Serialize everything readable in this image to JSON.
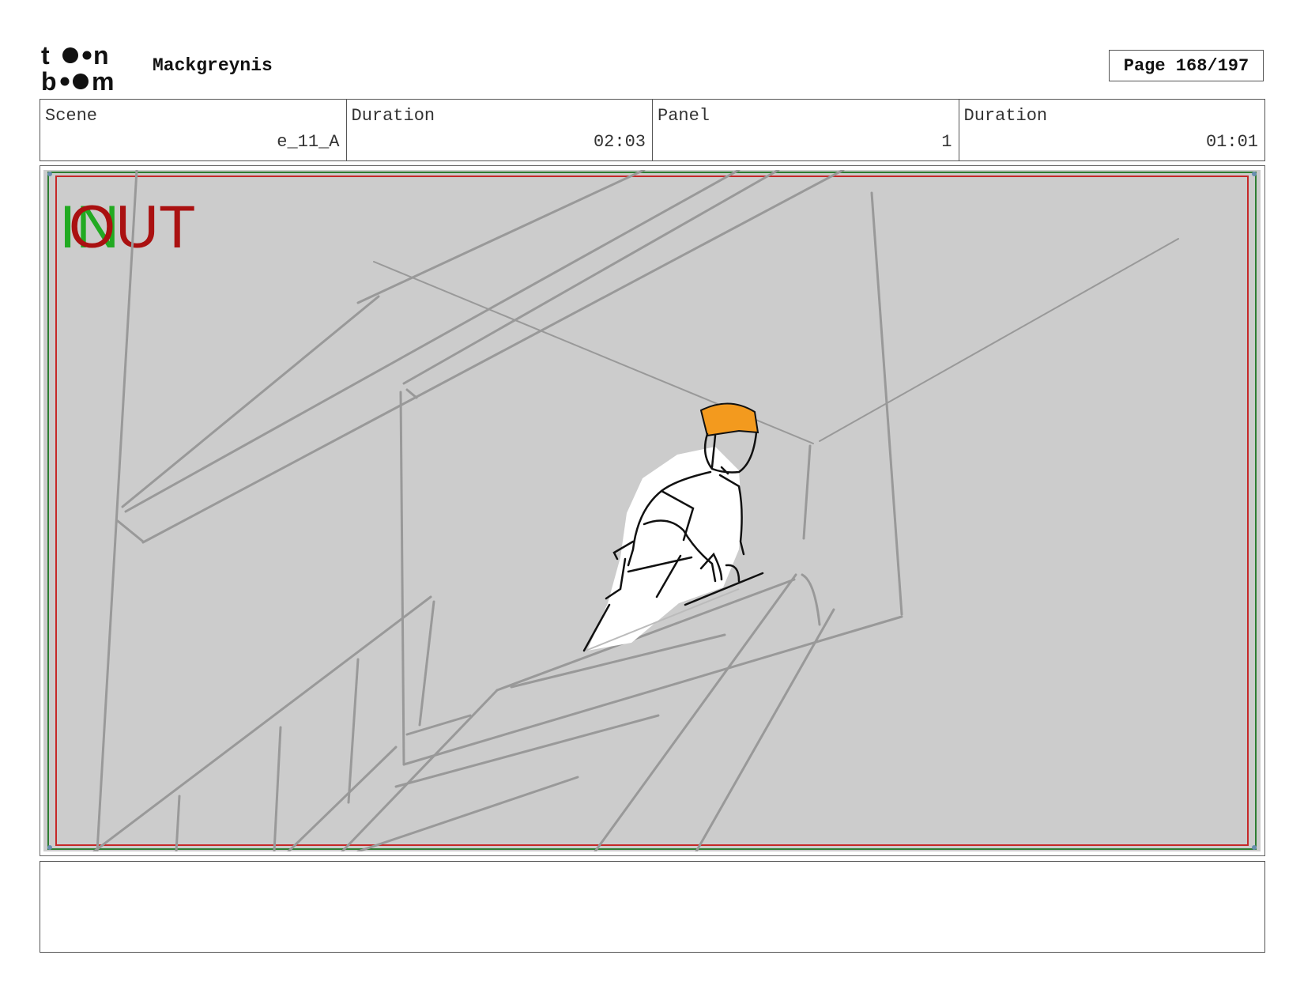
{
  "header": {
    "logo_top": "t●●n",
    "logo_bottom": "b●●m",
    "project_name": "Mackgreynis",
    "page_label": "Page 168/197"
  },
  "info": {
    "scene_label": "Scene",
    "scene_value": "e_11_A",
    "scene_duration_label": "Duration",
    "scene_duration_value": "02:03",
    "panel_label": "Panel",
    "panel_value": "1",
    "panel_duration_label": "Duration",
    "panel_duration_value": "01:01"
  },
  "panel": {
    "in_label": "IN",
    "out_label": "OUT",
    "colors": {
      "background": "#cccccc",
      "in_color": "#22aa22",
      "out_color": "#aa1111",
      "safe_green": "#2e7d32",
      "safe_red": "#c62828",
      "hat": "#f39a1e",
      "sketch": "#999999"
    }
  },
  "notes": {
    "text": ""
  }
}
